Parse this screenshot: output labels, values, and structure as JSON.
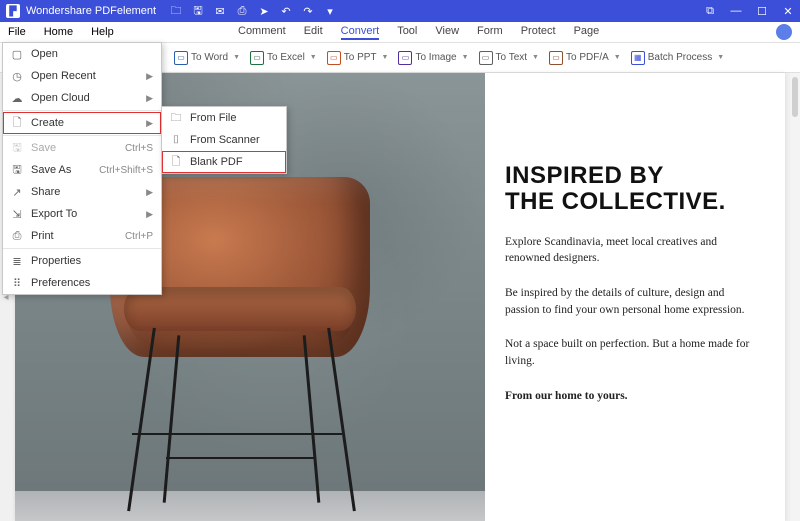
{
  "app": {
    "title": "Wondershare PDFelement"
  },
  "menubar": {
    "left": [
      "File",
      "Home",
      "Help"
    ],
    "tabs": [
      "Comment",
      "Edit",
      "Convert",
      "Tool",
      "View",
      "Form",
      "Protect",
      "Page"
    ],
    "active": "Convert"
  },
  "toolbar": [
    {
      "label": "To Word",
      "cls": "w"
    },
    {
      "label": "To Excel",
      "cls": "x"
    },
    {
      "label": "To PPT",
      "cls": "p"
    },
    {
      "label": "To Image",
      "cls": "i"
    },
    {
      "label": "To Text",
      "cls": "t"
    },
    {
      "label": "To PDF/A",
      "cls": "a"
    },
    {
      "label": "Batch Process",
      "cls": "b"
    }
  ],
  "filemenu": [
    {
      "icon": "open",
      "label": "Open",
      "shortcut": "",
      "sub": false
    },
    {
      "icon": "clock",
      "label": "Open Recent",
      "shortcut": "",
      "sub": true
    },
    {
      "icon": "cloud",
      "label": "Open Cloud",
      "shortcut": "",
      "sub": true
    },
    {
      "sep": true
    },
    {
      "icon": "doc",
      "label": "Create",
      "shortcut": "",
      "sub": true,
      "hl": true
    },
    {
      "sep": true
    },
    {
      "icon": "save",
      "label": "Save",
      "shortcut": "Ctrl+S",
      "sub": false,
      "disabled": true
    },
    {
      "icon": "saveas",
      "label": "Save As",
      "shortcut": "Ctrl+Shift+S",
      "sub": false
    },
    {
      "icon": "share",
      "label": "Share",
      "shortcut": "",
      "sub": true
    },
    {
      "icon": "export",
      "label": "Export To",
      "shortcut": "",
      "sub": true
    },
    {
      "icon": "print",
      "label": "Print",
      "shortcut": "Ctrl+P",
      "sub": false
    },
    {
      "sep": true
    },
    {
      "icon": "props",
      "label": "Properties",
      "shortcut": "",
      "sub": false
    },
    {
      "icon": "prefs",
      "label": "Preferences",
      "shortcut": "",
      "sub": false
    }
  ],
  "submenu": [
    {
      "icon": "folder",
      "label": "From File"
    },
    {
      "icon": "scanner",
      "label": "From Scanner"
    },
    {
      "icon": "blank",
      "label": "Blank PDF",
      "hl": true
    }
  ],
  "document": {
    "heading1": "INSPIRED BY",
    "heading2": "THE COLLECTIVE.",
    "p1": "Explore Scandinavia, meet local creatives and renowned designers.",
    "p2": "Be inspired by the details of culture, design and passion to find your own personal home expression.",
    "p3": "Not a space built on perfection. But a home made for living.",
    "p4": "From our home to yours."
  },
  "icons": {
    "open": "▢",
    "clock": "◷",
    "cloud": "☁",
    "doc": "🗋",
    "save": "🖫",
    "saveas": "🖫",
    "share": "↗",
    "export": "⇲",
    "print": "⎙",
    "props": "≣",
    "prefs": "⠿",
    "folder": "🗀",
    "scanner": "⌷",
    "blank": "🗋"
  }
}
